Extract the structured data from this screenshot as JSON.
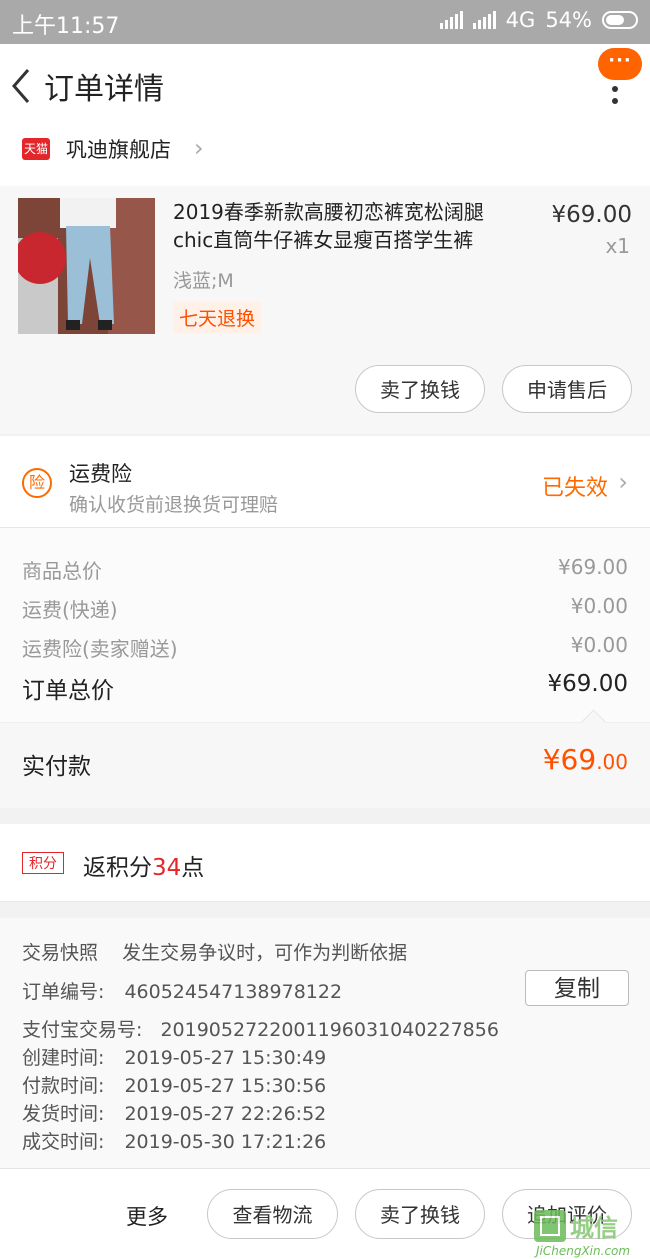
{
  "status_bar": {
    "time": "上午11:57",
    "network": "4G",
    "battery": "54%"
  },
  "header": {
    "title": "订单详情",
    "more_bubble": "···"
  },
  "store": {
    "badge": "天猫",
    "name": "巩迪旗舰店"
  },
  "product": {
    "title": "2019春季新款高腰初恋裤宽松阔腿chic直筒牛仔裤女显瘦百搭学生裤",
    "price": "¥69.00",
    "quantity": "x1",
    "spec": "浅蓝;M",
    "tag": "七天退换",
    "buttons": [
      "卖了换钱",
      "申请售后"
    ]
  },
  "insurance": {
    "icon_text": "险",
    "title": "运费险",
    "subtitle": "确认收货前退换货可理赔",
    "status": "已失效"
  },
  "summary": {
    "rows": [
      {
        "label": "商品总价",
        "value": "¥69.00"
      },
      {
        "label": "运费(快递)",
        "value": "¥0.00"
      },
      {
        "label": "运费险(卖家赠送)",
        "value": "¥0.00"
      }
    ],
    "total_label": "订单总价",
    "total_value": "¥69.00",
    "paid_label": "实付款",
    "paid_value_main": "¥69",
    "paid_value_decimal": ".00"
  },
  "points": {
    "badge": "积分",
    "prefix": "返积分",
    "number": "34",
    "suffix": "点"
  },
  "order_info": {
    "snapshot_label": "交易快照",
    "snapshot_note": "发生交易争议时，可作为判断依据",
    "copy_label": "复制",
    "rows": [
      {
        "label": "订单编号:",
        "value": "460524547138978122"
      },
      {
        "label": "支付宝交易号:",
        "value": "2019052722001196031040227856"
      },
      {
        "label": "创建时间:",
        "value": "2019-05-27 15:30:49"
      },
      {
        "label": "付款时间:",
        "value": "2019-05-27 15:30:56"
      },
      {
        "label": "发货时间:",
        "value": "2019-05-27 22:26:52"
      },
      {
        "label": "成交时间:",
        "value": "2019-05-30 17:21:26"
      }
    ]
  },
  "bottom_bar": {
    "more": "更多",
    "buttons": [
      "查看物流",
      "卖了换钱",
      "追加评价"
    ]
  },
  "watermark": {
    "cn": "城信",
    "en": "JiChengXin.com"
  },
  "colors": {
    "accent": "#ff5000",
    "tmall_red": "#e4262a",
    "status_bar": "#a9a9a9"
  }
}
